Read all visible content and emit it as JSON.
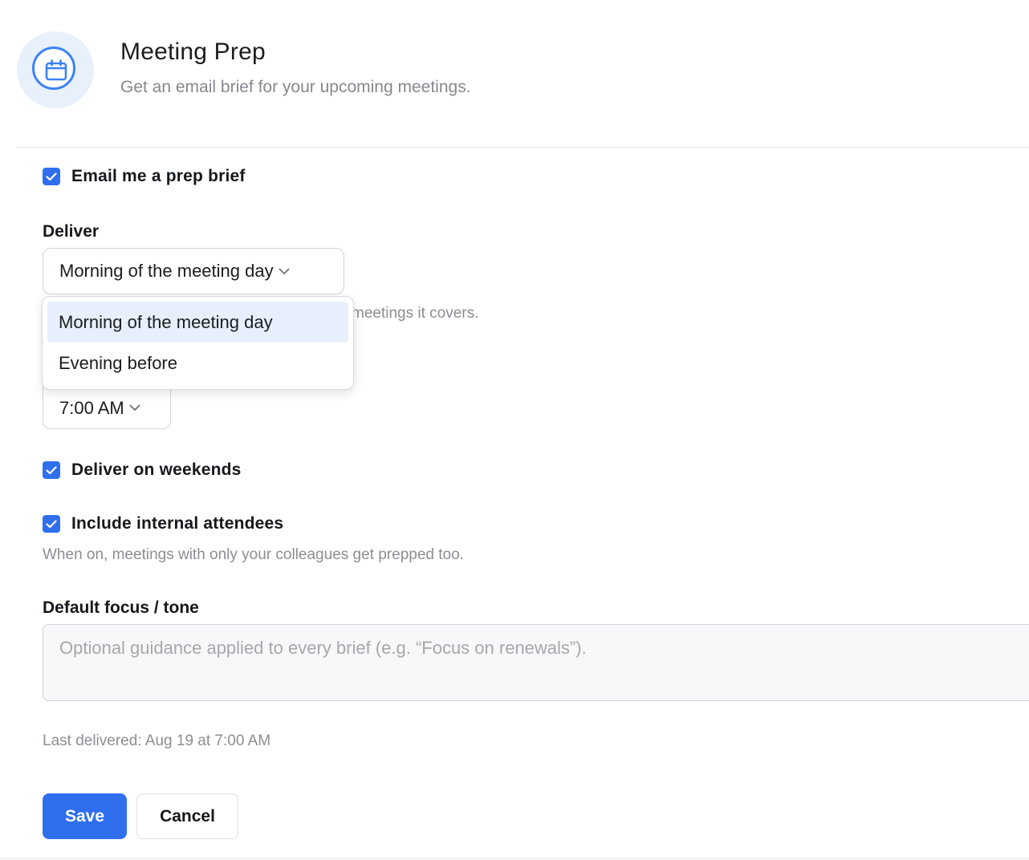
{
  "header": {
    "title": "Meeting Prep",
    "subtitle": "Get an email brief for your upcoming meetings.",
    "icon": "calendar-icon",
    "accent_color": "#3b82f6"
  },
  "email_brief": {
    "label": "Email me a prep brief",
    "checked": true
  },
  "deliver": {
    "label": "Deliver",
    "selected": "Morning of the meeting day",
    "options": [
      "Morning of the meeting day",
      "Evening before"
    ],
    "hint_visible": "meetings it covers.",
    "open": true
  },
  "time": {
    "selected": "7:00 AM"
  },
  "weekends": {
    "label": "Deliver on weekends",
    "checked": true
  },
  "internal": {
    "label": "Include internal attendees",
    "checked": true,
    "hint": "When on, meetings with only your colleagues get prepped too."
  },
  "focus": {
    "label": "Default focus / tone",
    "placeholder": "Optional guidance applied to every brief (e.g. “Focus on renewals”).",
    "value": ""
  },
  "status": {
    "last_delivered": "Last delivered: Aug 19 at 7:00 AM"
  },
  "actions": {
    "save_label": "Save",
    "cancel_label": "Cancel",
    "primary_color": "#2f6fed"
  }
}
